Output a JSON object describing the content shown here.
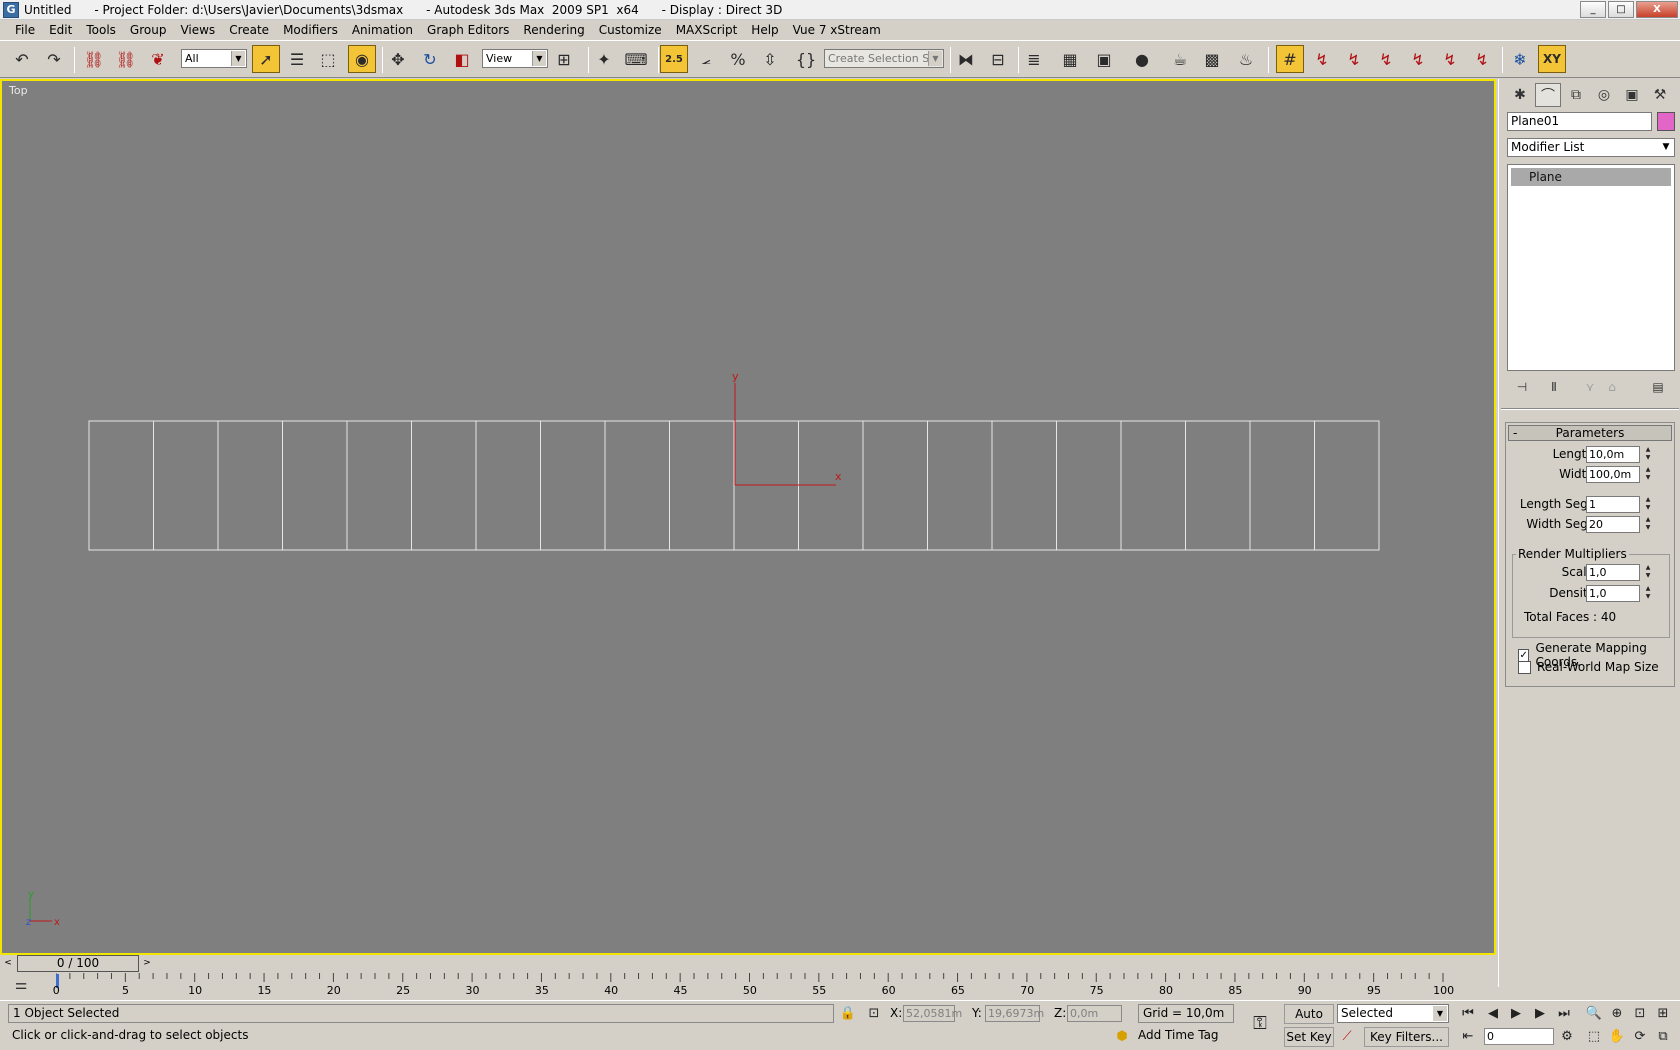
{
  "window": {
    "title": "Untitled      - Project Folder: d:\\Users\\Javier\\Documents\\3dsmax      - Autodesk 3ds Max  2009 SP1  x64      - Display : Direct 3D",
    "app_icon": "3ds-max-icon",
    "minimize": "_",
    "maximize": "□",
    "close": "X"
  },
  "menu": [
    "File",
    "Edit",
    "Tools",
    "Group",
    "Views",
    "Create",
    "Modifiers",
    "Animation",
    "Graph Editors",
    "Rendering",
    "Customize",
    "MAXScript",
    "Help",
    "Vue 7 xStream"
  ],
  "toolbar": {
    "selection_filter": "All",
    "ref_coord": "View",
    "named_selection_placeholder": "Create Selection Set",
    "snap_25": "2.5",
    "axis_constraint": "XY"
  },
  "viewport": {
    "label": "Top",
    "axis_y": "y",
    "axis_x": "x",
    "axis_z": "z",
    "grid_color": "#e6e6e6",
    "gizmo_color": "#c01818",
    "border_color": "#f2e500"
  },
  "command_panel": {
    "object_name": "Plane01",
    "object_color": "#e266c8",
    "modifier_list": "Modifier List",
    "stack_item": "Plane",
    "rollout_title": "Parameters",
    "rollout_toggle": "-",
    "params": {
      "length_label": "Length:",
      "length_value": "10,0m",
      "width_label": "Width:",
      "width_value": "100,0m",
      "length_segs_label": "Length Segs:",
      "length_segs_value": "1",
      "width_segs_label": "Width Segs:",
      "width_segs_value": "20",
      "render_multipliers": "Render Multipliers",
      "scale_label": "Scale:",
      "scale_value": "1,0",
      "density_label": "Density:",
      "density_value": "1,0",
      "total_faces": "Total Faces : 40",
      "gen_mapping": "Generate Mapping Coords.",
      "gen_mapping_checked": true,
      "real_world": "Real-World Map Size",
      "real_world_checked": false
    }
  },
  "timeslider": {
    "position": "0 / 100",
    "prev": "<",
    "next": ">"
  },
  "trackbar": {
    "ticks": [
      "0",
      "5",
      "10",
      "15",
      "20",
      "25",
      "30",
      "35",
      "40",
      "45",
      "50",
      "55",
      "60",
      "65",
      "70",
      "75",
      "80",
      "85",
      "90",
      "95",
      "100"
    ]
  },
  "status": {
    "selection": "1 Object Selected",
    "prompt": "Click or click-and-drag to select objects",
    "x_label": "X:",
    "x_value": "52,0581m",
    "y_label": "Y:",
    "y_value": "19,6973m",
    "z_label": "Z:",
    "z_value": "0,0m",
    "grid": "Grid = 10,0m",
    "add_time_tag": "Add Time Tag",
    "auto_key": "Auto Key",
    "set_key": "Set Key",
    "key_mode": "Selected",
    "key_filters": "Key Filters...",
    "current_frame": "0"
  }
}
